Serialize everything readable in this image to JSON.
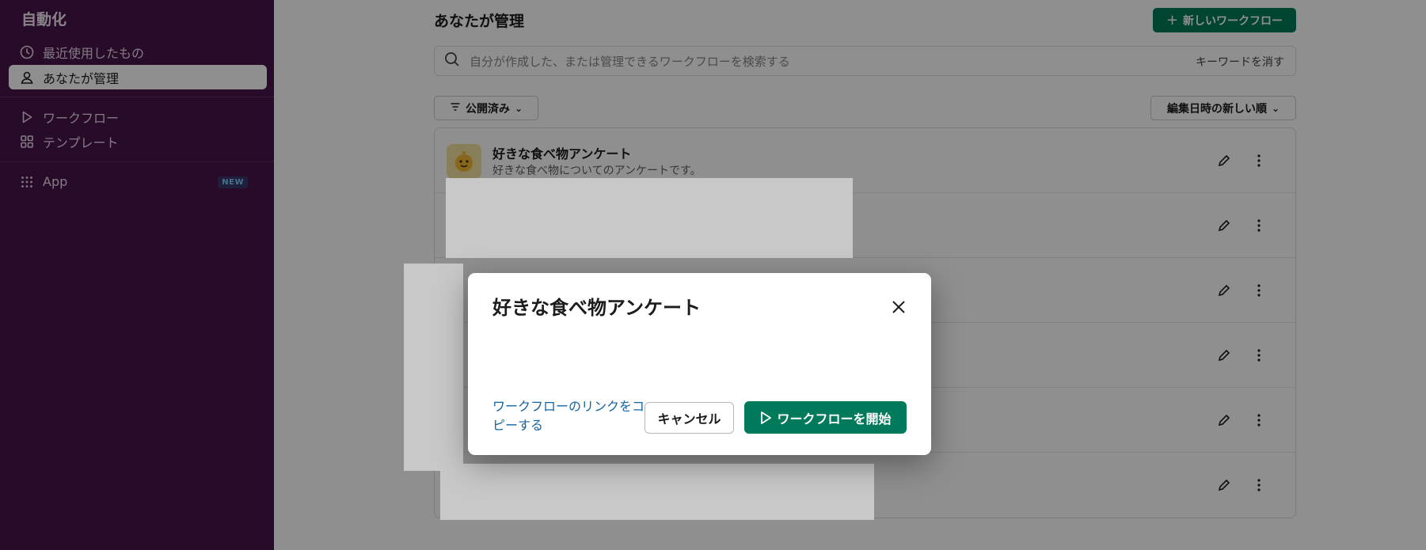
{
  "sidebar": {
    "title": "自動化",
    "items": [
      {
        "label": "最近使用したもの",
        "icon": "clock-icon"
      },
      {
        "label": "あなたが管理",
        "icon": "person-icon"
      },
      {
        "label": "ワークフロー",
        "icon": "play-icon"
      },
      {
        "label": "テンプレート",
        "icon": "grid-icon"
      },
      {
        "label": "App",
        "icon": "apps-grid-icon",
        "badge": "NEW"
      }
    ]
  },
  "main": {
    "title": "あなたが管理",
    "new_button": "新しいワークフロー",
    "search_placeholder": "自分が作成した、または管理できるワークフローを検索する",
    "clear_keywords": "キーワードを消す",
    "filter_label": "公開済み",
    "sort_label": "編集日時の新しい順",
    "rows": [
      {
        "name": "好きな食べ物アンケート",
        "description": "好きな食べ物についてのアンケートです。"
      }
    ]
  },
  "modal": {
    "title": "好きな食べ物アンケート",
    "copy_link": "ワークフローのリンクをコピーする",
    "cancel": "キャンセル",
    "start": "ワークフローを開始"
  },
  "colors": {
    "sidebar_bg": "#481349",
    "primary": "#007a5a",
    "link": "#1264a3"
  }
}
